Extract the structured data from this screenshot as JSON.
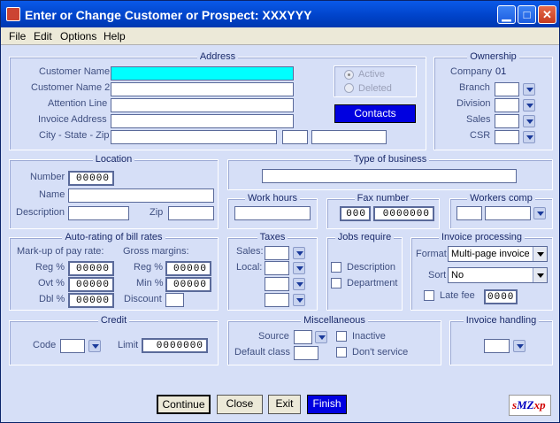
{
  "window": {
    "title": "Enter or Change Customer or Prospect:  XXXYYY"
  },
  "menu": {
    "file": "File",
    "edit": "Edit",
    "options": "Options",
    "help": "Help"
  },
  "address": {
    "title": "Address",
    "customer_name_label": "Customer Name",
    "customer_name2_label": "Customer Name 2",
    "attention_label": "Attention Line",
    "invoice_address_label": "Invoice Address",
    "city_label": "City - State - Zip",
    "active_label": "Active",
    "deleted_label": "Deleted",
    "contacts_label": "Contacts"
  },
  "ownership": {
    "title": "Ownership",
    "company_label": "Company",
    "company_value": "01",
    "branch_label": "Branch",
    "division_label": "Division",
    "sales_label": "Sales",
    "csr_label": "CSR"
  },
  "location": {
    "title": "Location",
    "number_label": "Number",
    "number_value": "00000",
    "name_label": "Name",
    "description_label": "Description",
    "zip_label": "Zip"
  },
  "business": {
    "title": "Type of business"
  },
  "work_hours": {
    "title": "Work hours"
  },
  "fax": {
    "title": "Fax number",
    "area": "000",
    "number": "0000000"
  },
  "workers_comp": {
    "title": "Workers comp"
  },
  "autorating": {
    "title": "Auto-rating of bill rates",
    "markup_label": "Mark-up of pay rate:",
    "gross_label": "Gross margins:",
    "reg_label": "Reg %",
    "ovt_label": "Ovt %",
    "dbl_label": "Dbl %",
    "reg_value": "00000",
    "ovt_value": "00000",
    "dbl_value": "00000",
    "greg_label": "Reg %",
    "min_label": "Min %",
    "discount_label": "Discount",
    "greg_value": "00000",
    "min_value": "00000"
  },
  "taxes": {
    "title": "Taxes",
    "sales_label": "Sales:",
    "local_label": "Local:"
  },
  "jobs": {
    "title": "Jobs require",
    "description_label": "Description",
    "department_label": "Department"
  },
  "invoice": {
    "title": "Invoice processing",
    "format_label": "Format",
    "format_value": "Multi-page invoice",
    "sort_label": "Sort",
    "sort_value": "No",
    "latefee_label": "Late fee",
    "latefee_value": "0000"
  },
  "credit": {
    "title": "Credit",
    "code_label": "Code",
    "limit_label": "Limit",
    "limit_value": "0000000"
  },
  "misc": {
    "title": "Miscellaneous",
    "source_label": "Source",
    "default_class_label": "Default class",
    "inactive_label": "Inactive",
    "dont_service_label": "Don't service"
  },
  "invoice_handling": {
    "title": "Invoice handling"
  },
  "buttons": {
    "continue": "Continue",
    "close": "Close",
    "exit": "Exit",
    "finish": "Finish"
  },
  "logo": {
    "text": "sMZxp"
  }
}
